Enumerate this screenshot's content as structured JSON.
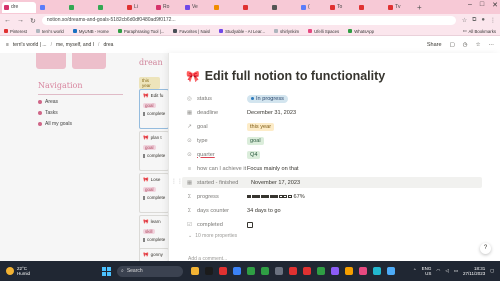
{
  "browser": {
    "tabs": [
      {
        "label": "dre",
        "color": "#d6336c",
        "active": true
      },
      {
        "label": "",
        "color": "#5b7cfa"
      },
      {
        "label": "",
        "color": "#34a853"
      },
      {
        "label": "",
        "color": "#34a853"
      },
      {
        "label": "Li",
        "color": "#e03131"
      },
      {
        "label": "Ro",
        "color": "#d6336c"
      },
      {
        "label": "Ve",
        "color": "#7048e8"
      },
      {
        "label": "",
        "color": "#f08c00"
      },
      {
        "label": "",
        "color": "#e03131"
      },
      {
        "label": "",
        "color": "#555555"
      },
      {
        "label": "(",
        "color": "#5b7cfa"
      },
      {
        "label": "To",
        "color": "#e03131"
      },
      {
        "label": "",
        "color": "#e03131"
      },
      {
        "label": "Tv",
        "color": "#e03131"
      }
    ],
    "url": "notion.so/dreams-and-goals-5182cb6d0df0480ad9f0172...",
    "bookmarks": [
      {
        "label": "Pinterest",
        "color": "#e03131"
      },
      {
        "label": "terri's world",
        "color": "#adb5bd"
      },
      {
        "label": "MyUNB - Home",
        "color": "#1971c2"
      },
      {
        "label": "Paraphrasing Tool |...",
        "color": "#2f9e44"
      },
      {
        "label": "Favorites | Naisl",
        "color": "#495057"
      },
      {
        "label": "Studyable - AI Lear...",
        "color": "#7048e8"
      },
      {
        "label": "shirlynkim",
        "color": "#adb5bd"
      },
      {
        "label": "Ufelli Spaces",
        "color": "#e64980"
      },
      {
        "label": "WhatsApp",
        "color": "#2f9e44"
      }
    ],
    "all_bookmarks": "All Bookmarks"
  },
  "notion_top": {
    "crumbs": [
      "terri's world | ...",
      "me, myself, and I",
      "drea"
    ],
    "share": "Share"
  },
  "bg": {
    "nav_heading": "Navigation",
    "nav_items": [
      "Areas",
      "Tasks",
      "All my goals"
    ],
    "dream_title": "drean",
    "year_chip": "this year",
    "cards": [
      {
        "title": "Edit fu",
        "tag": "goal",
        "check": "complete"
      },
      {
        "title": "plan t",
        "tag": "goal",
        "check": "complete"
      },
      {
        "title": "Lose",
        "tag": "goal",
        "check": "complete"
      },
      {
        "title": "learn",
        "tag": "skill",
        "check": "complete"
      },
      {
        "title": "gonny",
        "tag": "",
        "check": ""
      }
    ]
  },
  "page": {
    "title": "Edit full notion to functionality",
    "title_icon": "ribbon-icon",
    "properties": {
      "status": {
        "label": "status",
        "value": "In progress"
      },
      "deadline": {
        "label": "deadline",
        "value": "December 31, 2023"
      },
      "goal": {
        "label": "goal",
        "value": "this year"
      },
      "type": {
        "label": "type",
        "value": "goal"
      },
      "quarter": {
        "label": "quarter",
        "value": "Q4"
      },
      "how": {
        "label": "how can I achieve it",
        "value": "Focus mainly on that"
      },
      "started": {
        "label": "started - finished",
        "value": "November 17, 2023"
      },
      "progress": {
        "label": "progress",
        "value": "67%",
        "fraction": 0.67
      },
      "days": {
        "label": "days counter",
        "value": "34 days to go"
      },
      "completed": {
        "label": "completed",
        "checked": false
      }
    },
    "more_properties": "10 more properties",
    "add_comment": "Add a comment..."
  },
  "taskbar": {
    "temp": "22°C",
    "weather": "Humid",
    "search": "Search",
    "lang": "ENG",
    "region": "US",
    "time": "18:31",
    "date": "27/11/2023",
    "apps": [
      "#f2b233",
      "#1b1b1b",
      "#e03131",
      "#3b82f6",
      "#2f9e44",
      "#2f9e44",
      "#6b7280",
      "#e03131",
      "#e03131",
      "#2f9e44",
      "#8b5cf6",
      "#f59f00",
      "#e64980",
      "#22b8cf",
      "#4dabf7"
    ]
  }
}
